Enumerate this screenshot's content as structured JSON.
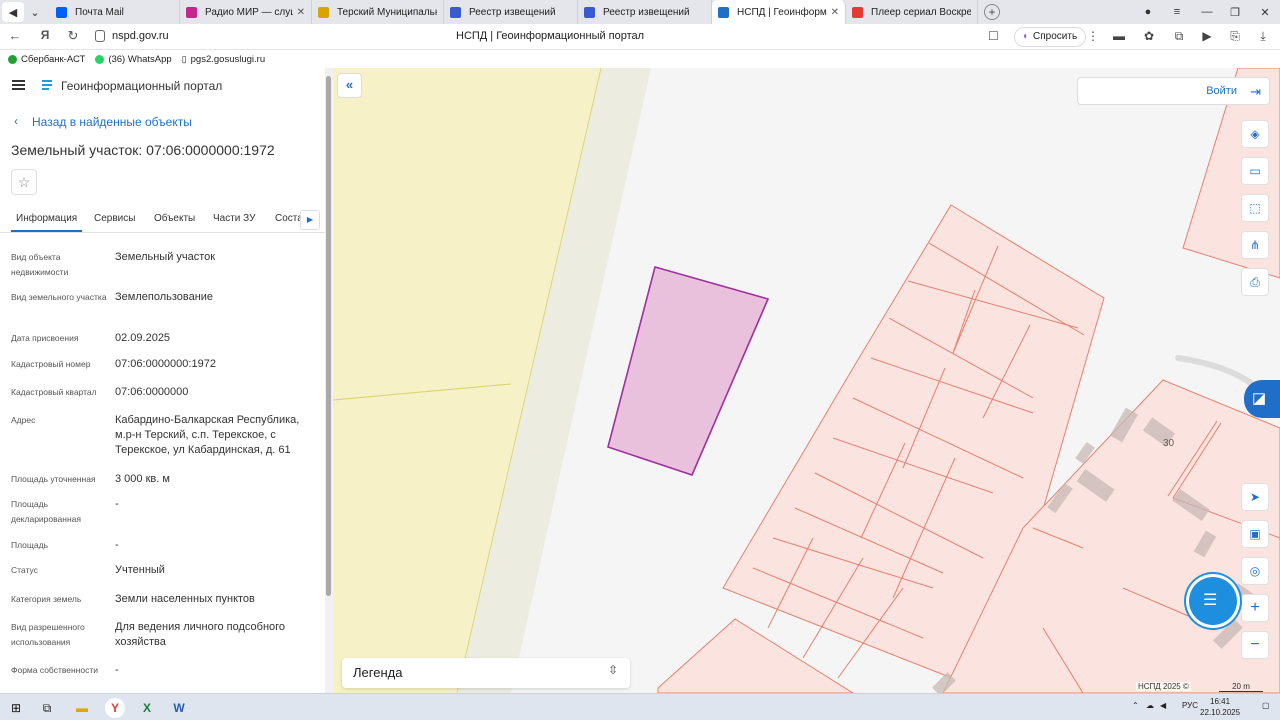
{
  "browser": {
    "tabs": [
      {
        "label": "Почта Mail",
        "color": "#005ff9"
      },
      {
        "label": "Радио МИР — слушать",
        "color": "#c3268f"
      },
      {
        "label": "Терский Муниципальный",
        "color": "#d9a300"
      },
      {
        "label": "Реестр извещений",
        "color": "#3a5bd0"
      },
      {
        "label": "Реестр извещений",
        "color": "#3a5bd0"
      },
      {
        "label": "НСПД | Геоинформационный",
        "color": "#1f6fc9"
      },
      {
        "label": "Плеер сериал Воскресшие",
        "color": "#e53935"
      }
    ],
    "url": "nspd.gov.ru",
    "page_title": "НСПД | Геоинформационный портал",
    "ask_label": "Спросить",
    "bookmarks": [
      "Сбербанк-АСТ",
      "(36) WhatsApp",
      "pgs2.gosuslugi.ru"
    ]
  },
  "sidebar": {
    "portal_name": "Геоинформационный портал",
    "back_label": "Назад в найденные объекты",
    "title": "Земельный участок: 07:06:0000000:1972",
    "tabs": [
      "Информация",
      "Сервисы",
      "Объекты",
      "Части ЗУ",
      "Соста"
    ],
    "fields": [
      {
        "label": "Вид объекта недвижимости",
        "value": "Земельный участок"
      },
      {
        "label": "Вид земельного участка",
        "value": "Землепользование"
      },
      {
        "label": "Дата присвоения",
        "value": "02.09.2025"
      },
      {
        "label": "Кадастровый номер",
        "value": "07:06:0000000:1972"
      },
      {
        "label": "Кадастровый квартал",
        "value": "07:06:0000000"
      },
      {
        "label": "Адрес",
        "value": "Кабардино-Балкарская Республика, м.р-н Терский, с.п. Терекское, с Терекское, ул Кабардинская, д. 61"
      },
      {
        "label": "Площадь уточненная",
        "value": "3 000 кв. м"
      },
      {
        "label": "Площадь декларированная",
        "value": "-"
      },
      {
        "label": "Площадь",
        "value": "-"
      },
      {
        "label": "Статус",
        "value": "Учтенный"
      },
      {
        "label": "Категория земель",
        "value": "Земли населенных пунктов"
      },
      {
        "label": "Вид разрешенного использования",
        "value": "Для ведения личного подсобного хозяйства"
      },
      {
        "label": "Форма собственности",
        "value": "-"
      }
    ]
  },
  "map": {
    "login_label": "Войти",
    "legend_label": "Легенда",
    "house_number": "30",
    "copyright": "НСПД 2025 ©",
    "scale": "20 m",
    "colors": {
      "selected_fill": "#e9c1dc",
      "selected_stroke": "#a02fa0",
      "parcel_fill": "#fbe3df",
      "parcel_stroke": "#e8806e",
      "zone_fill": "#f6f1c7"
    }
  },
  "taskbar": {
    "lang": "РУС",
    "time": "16:41",
    "date": "22.10.2025"
  }
}
